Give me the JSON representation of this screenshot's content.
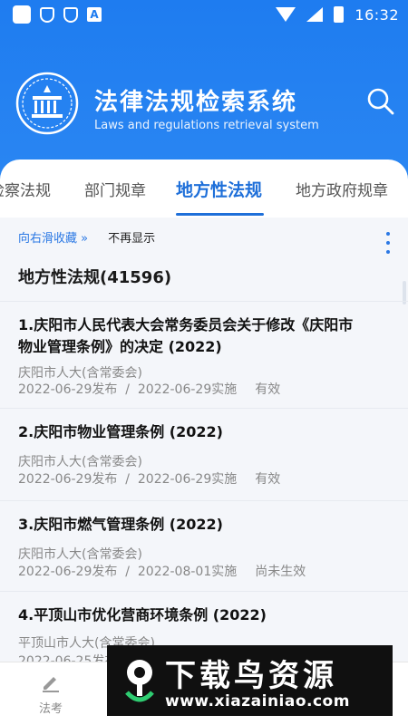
{
  "status_bar": {
    "time": "16:32",
    "a_icon": "A"
  },
  "app": {
    "title": "法律法规检索系统",
    "subtitle": "Laws and regulations retrieval system"
  },
  "tabs": [
    {
      "label": "检察法规"
    },
    {
      "label": "部门规章"
    },
    {
      "label": "地方性法规",
      "active": true
    },
    {
      "label": "地方政府规章"
    }
  ],
  "hint": {
    "swipe_label": "向右滑收藏 »",
    "dismiss_label": "不再显示"
  },
  "section_title": "地方性法规(41596)",
  "items": [
    {
      "title": "1.庆阳市人民代表大会常务委员会关于修改《庆阳市物业管理条例》的决定 (2022)",
      "org": "庆阳市人大(含常委会)",
      "meta": "2022-06-29发布  /  2022-06-29实施",
      "status": "有效"
    },
    {
      "title": "2.庆阳市物业管理条例 (2022)",
      "org": "庆阳市人大(含常委会)",
      "meta": "2022-06-29发布  /  2022-06-29实施",
      "status": "有效"
    },
    {
      "title": "3.庆阳市燃气管理条例 (2022)",
      "org": "庆阳市人大(含常委会)",
      "meta": "2022-06-29发布  /  2022-08-01实施",
      "status": "尚未生效"
    },
    {
      "title": "4.平顶山市优化营商环境条例 (2022)",
      "org": "平顶山市人大(含常委会)",
      "meta": "2022-06-25发布",
      "status": ""
    }
  ],
  "bottom_nav": {
    "item1_label": "法考"
  },
  "watermark": {
    "title": "下载鸟资源",
    "url": "www.xiazainiao.com"
  },
  "colors": {
    "header_blue": "#1e7cf0",
    "accent": "#1e6fd9",
    "link": "#2a78e4"
  },
  "icons": [
    "shield-icon",
    "a-icon",
    "wifi-icon",
    "signal-icon",
    "battery-icon",
    "emblem-icon",
    "search-icon",
    "more-icon",
    "pen-icon"
  ]
}
